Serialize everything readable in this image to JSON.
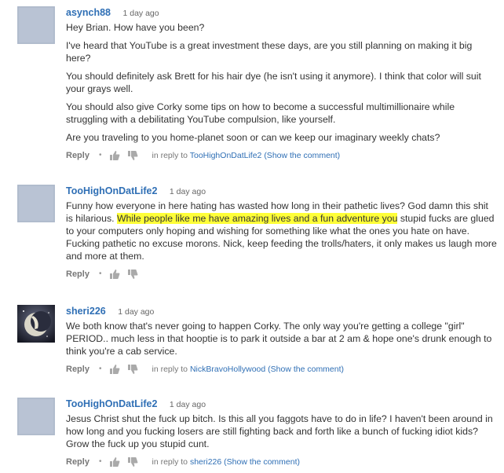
{
  "comments": [
    {
      "author": "asynch88",
      "time": "1 day ago",
      "avatar": "default-avatar",
      "paragraphs": [
        "Hey Brian. How have you been?",
        "I've heard that YouTube is a great investment these days, are you still planning on making it big here?",
        "You should definitely ask Brett for his hair dye (he isn't using it anymore). I think that color will suit your grays well.",
        "You should also give Corky some tips on how to become a successful multimillionaire while struggling with a debilitating YouTube compulsion, like yourself.",
        "Are you traveling to you home-planet soon or can we keep our imaginary weekly chats?"
      ],
      "reply_label": "Reply",
      "in_reply_prefix": "in reply to",
      "in_reply_user": "TooHighOnDatLife2",
      "show_comment": "(Show the comment)"
    },
    {
      "author": "TooHighOnDatLife2",
      "time": "1 day ago",
      "avatar": "default-avatar",
      "text_before": "Funny how everyone in here hating has wasted how long in their pathetic lives? God damn this shit is hilarious. ",
      "text_highlight": "While people like me have amazing lives and a fun adventure you",
      "text_after": " stupid fucks are glued to your computers only hoping and wishing for something like what the ones you hate on have. Fucking pathetic no excuse morons. Nick, keep feeding the trolls/haters, it only makes us laugh more and more at them.",
      "reply_label": "Reply"
    },
    {
      "author": "sheri226",
      "time": "1 day ago",
      "avatar": "moon-fairy-avatar",
      "paragraphs": [
        "We both know that's never going to happen Corky. The only way you're getting a college \"girl\" PERIOD.. much less in that hooptie is to park it outside a bar at 2 am & hope one's drunk enough to think you're a cab service."
      ],
      "reply_label": "Reply",
      "in_reply_prefix": "in reply to",
      "in_reply_user": "NickBravoHollywood",
      "show_comment": "(Show the comment)"
    },
    {
      "author": "TooHighOnDatLife2",
      "time": "1 day ago",
      "avatar": "default-avatar",
      "paragraphs": [
        "Jesus Christ shut the fuck up bitch. Is this all you faggots have to do in life? I haven't been around in how long and you fucking losers are still fighting back and forth like a bunch of fucking idiot kids? Grow the fuck up you stupid cunt."
      ],
      "reply_label": "Reply",
      "in_reply_prefix": "in reply to",
      "in_reply_user": "sheri226",
      "show_comment": "(Show the comment)"
    }
  ],
  "colors": {
    "link": "#2f6fb5",
    "highlight": "#ffff38",
    "avatar_default": "#b9c3d4"
  }
}
